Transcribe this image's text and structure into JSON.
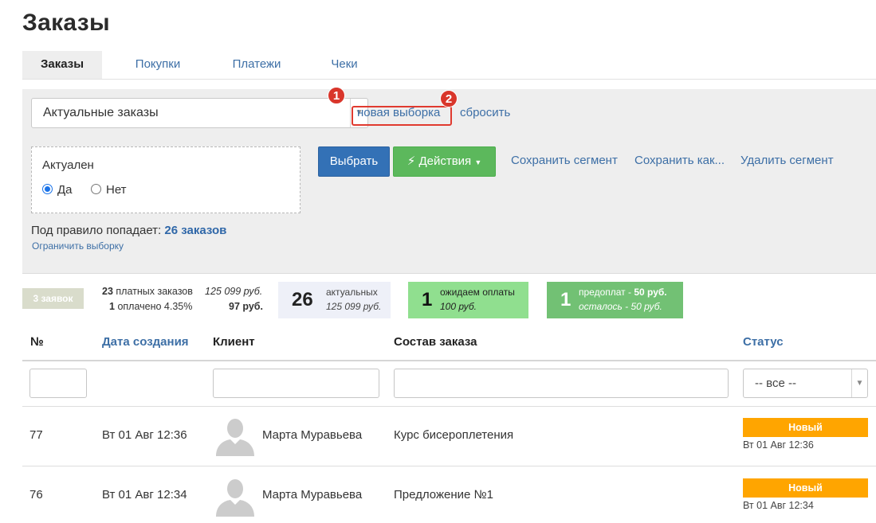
{
  "page_title": "Заказы",
  "tabs": [
    {
      "label": "Заказы",
      "active": true
    },
    {
      "label": "Покупки",
      "active": false
    },
    {
      "label": "Платежи",
      "active": false
    },
    {
      "label": "Чеки",
      "active": false
    }
  ],
  "filter": {
    "segment_value": "Актуальные заказы",
    "new_selection": "новая выборка",
    "reset": "сбросить",
    "markers": [
      "1",
      "2"
    ],
    "condition_label": "Актуален",
    "radio_yes": "Да",
    "radio_no": "Нет",
    "radio_selected": "Да",
    "btn_select": "Выбрать",
    "btn_actions": "Действия",
    "save_segment": "Сохранить сегмент",
    "save_as": "Сохранить как...",
    "delete_segment": "Удалить сегмент",
    "rule_prefix": "Под правило попадает:",
    "rule_count": "26 заказов",
    "limit": "Ограничить выборку"
  },
  "stats": {
    "requests": "3 заявок",
    "paid_count": "23",
    "paid_label": "платных заказов",
    "paid_sum": "125 099 руб.",
    "paid_done_count": "1",
    "paid_done_label": "оплачено 4.35%",
    "paid_done_sum": "97 руб.",
    "actual_num": "26",
    "actual_label": "актуальных",
    "actual_sum": "125 099 руб.",
    "wait_num": "1",
    "wait_label": "ожидаем оплаты",
    "wait_sum": "100 руб.",
    "prepay_num": "1",
    "prepay_label": "предоплат -",
    "prepay_sum": "50 руб.",
    "left_label": "осталось -",
    "left_sum": "50 руб."
  },
  "table": {
    "headers": {
      "num": "№",
      "date": "Дата создания",
      "client": "Клиент",
      "content": "Состав заказа",
      "status": "Статус"
    },
    "status_filter": "-- все --",
    "rows": [
      {
        "num": "77",
        "date": "Вт 01 Авг 12:36",
        "client": "Марта Муравьева",
        "content": "Курс бисероплетения",
        "status": "Новый",
        "status_time": "Вт 01 Авг 12:36"
      },
      {
        "num": "76",
        "date": "Вт 01 Авг 12:34",
        "client": "Марта Муравьева",
        "content": "Предложение №1",
        "status": "Новый",
        "status_time": "Вт 01 Авг 12:34"
      }
    ]
  },
  "colors": {
    "link": "#3d6fa6",
    "primary": "#3371b6",
    "success": "#5cb85c",
    "status_new": "#ffa500",
    "marker": "#d9362b"
  }
}
